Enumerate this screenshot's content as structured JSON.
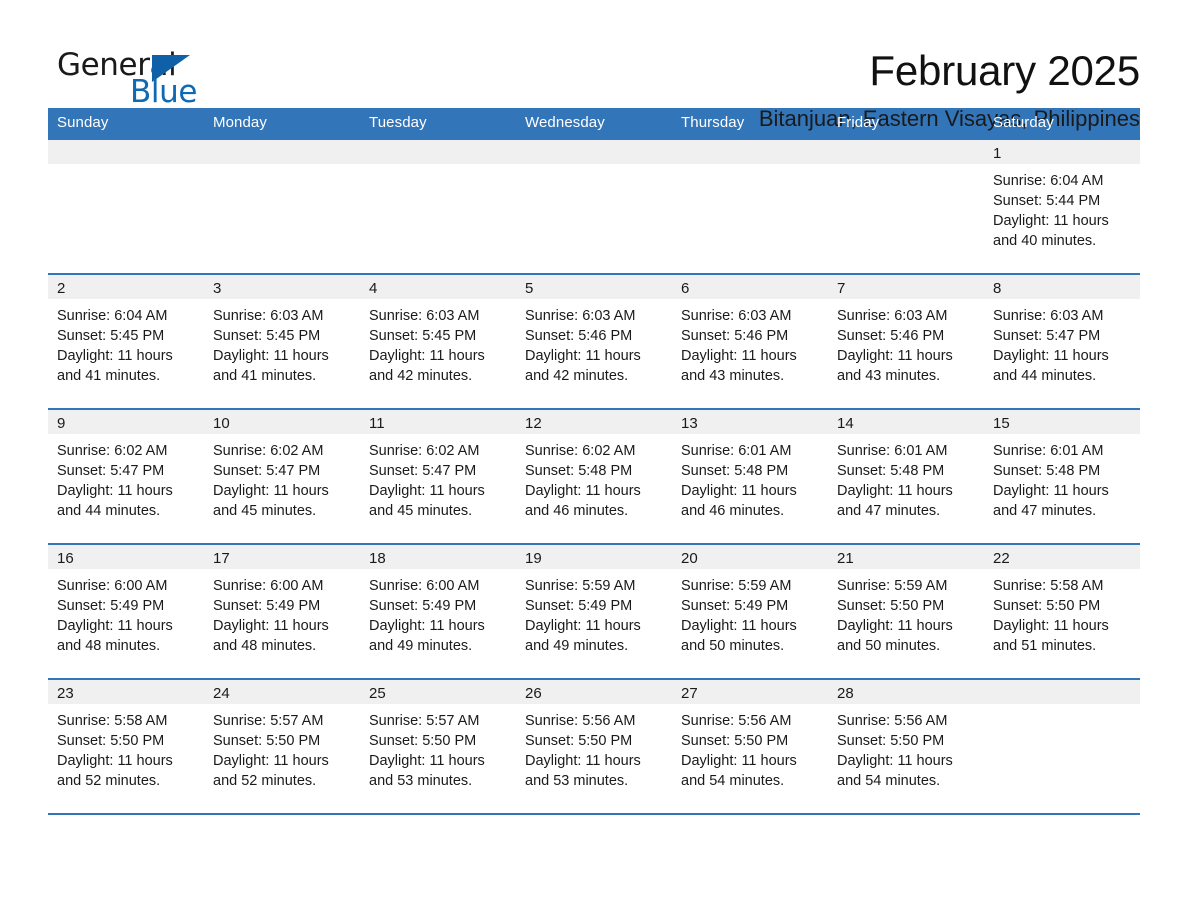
{
  "brand": {
    "name_part1": "General",
    "name_part2": "Blue",
    "triangle_icon": "triangle-icon",
    "accent_color": "#0f6ab4"
  },
  "header": {
    "title": "February 2025",
    "location": "Bitanjuan, Eastern Visayas, Philippines"
  },
  "calendar": {
    "header_bg": "#3275b8",
    "daynum_bg": "#f0f0f0",
    "weekdays": [
      "Sunday",
      "Monday",
      "Tuesday",
      "Wednesday",
      "Thursday",
      "Friday",
      "Saturday"
    ],
    "labels": {
      "sunrise": "Sunrise:",
      "sunset": "Sunset:",
      "daylight": "Daylight:"
    },
    "weeks": [
      [
        {
          "day": ""
        },
        {
          "day": ""
        },
        {
          "day": ""
        },
        {
          "day": ""
        },
        {
          "day": ""
        },
        {
          "day": ""
        },
        {
          "day": "1",
          "sunrise": "Sunrise: 6:04 AM",
          "sunset": "Sunset: 5:44 PM",
          "daylight_line1": "Daylight: 11 hours",
          "daylight_line2": "and 40 minutes."
        }
      ],
      [
        {
          "day": "2",
          "sunrise": "Sunrise: 6:04 AM",
          "sunset": "Sunset: 5:45 PM",
          "daylight_line1": "Daylight: 11 hours",
          "daylight_line2": "and 41 minutes."
        },
        {
          "day": "3",
          "sunrise": "Sunrise: 6:03 AM",
          "sunset": "Sunset: 5:45 PM",
          "daylight_line1": "Daylight: 11 hours",
          "daylight_line2": "and 41 minutes."
        },
        {
          "day": "4",
          "sunrise": "Sunrise: 6:03 AM",
          "sunset": "Sunset: 5:45 PM",
          "daylight_line1": "Daylight: 11 hours",
          "daylight_line2": "and 42 minutes."
        },
        {
          "day": "5",
          "sunrise": "Sunrise: 6:03 AM",
          "sunset": "Sunset: 5:46 PM",
          "daylight_line1": "Daylight: 11 hours",
          "daylight_line2": "and 42 minutes."
        },
        {
          "day": "6",
          "sunrise": "Sunrise: 6:03 AM",
          "sunset": "Sunset: 5:46 PM",
          "daylight_line1": "Daylight: 11 hours",
          "daylight_line2": "and 43 minutes."
        },
        {
          "day": "7",
          "sunrise": "Sunrise: 6:03 AM",
          "sunset": "Sunset: 5:46 PM",
          "daylight_line1": "Daylight: 11 hours",
          "daylight_line2": "and 43 minutes."
        },
        {
          "day": "8",
          "sunrise": "Sunrise: 6:03 AM",
          "sunset": "Sunset: 5:47 PM",
          "daylight_line1": "Daylight: 11 hours",
          "daylight_line2": "and 44 minutes."
        }
      ],
      [
        {
          "day": "9",
          "sunrise": "Sunrise: 6:02 AM",
          "sunset": "Sunset: 5:47 PM",
          "daylight_line1": "Daylight: 11 hours",
          "daylight_line2": "and 44 minutes."
        },
        {
          "day": "10",
          "sunrise": "Sunrise: 6:02 AM",
          "sunset": "Sunset: 5:47 PM",
          "daylight_line1": "Daylight: 11 hours",
          "daylight_line2": "and 45 minutes."
        },
        {
          "day": "11",
          "sunrise": "Sunrise: 6:02 AM",
          "sunset": "Sunset: 5:47 PM",
          "daylight_line1": "Daylight: 11 hours",
          "daylight_line2": "and 45 minutes."
        },
        {
          "day": "12",
          "sunrise": "Sunrise: 6:02 AM",
          "sunset": "Sunset: 5:48 PM",
          "daylight_line1": "Daylight: 11 hours",
          "daylight_line2": "and 46 minutes."
        },
        {
          "day": "13",
          "sunrise": "Sunrise: 6:01 AM",
          "sunset": "Sunset: 5:48 PM",
          "daylight_line1": "Daylight: 11 hours",
          "daylight_line2": "and 46 minutes."
        },
        {
          "day": "14",
          "sunrise": "Sunrise: 6:01 AM",
          "sunset": "Sunset: 5:48 PM",
          "daylight_line1": "Daylight: 11 hours",
          "daylight_line2": "and 47 minutes."
        },
        {
          "day": "15",
          "sunrise": "Sunrise: 6:01 AM",
          "sunset": "Sunset: 5:48 PM",
          "daylight_line1": "Daylight: 11 hours",
          "daylight_line2": "and 47 minutes."
        }
      ],
      [
        {
          "day": "16",
          "sunrise": "Sunrise: 6:00 AM",
          "sunset": "Sunset: 5:49 PM",
          "daylight_line1": "Daylight: 11 hours",
          "daylight_line2": "and 48 minutes."
        },
        {
          "day": "17",
          "sunrise": "Sunrise: 6:00 AM",
          "sunset": "Sunset: 5:49 PM",
          "daylight_line1": "Daylight: 11 hours",
          "daylight_line2": "and 48 minutes."
        },
        {
          "day": "18",
          "sunrise": "Sunrise: 6:00 AM",
          "sunset": "Sunset: 5:49 PM",
          "daylight_line1": "Daylight: 11 hours",
          "daylight_line2": "and 49 minutes."
        },
        {
          "day": "19",
          "sunrise": "Sunrise: 5:59 AM",
          "sunset": "Sunset: 5:49 PM",
          "daylight_line1": "Daylight: 11 hours",
          "daylight_line2": "and 49 minutes."
        },
        {
          "day": "20",
          "sunrise": "Sunrise: 5:59 AM",
          "sunset": "Sunset: 5:49 PM",
          "daylight_line1": "Daylight: 11 hours",
          "daylight_line2": "and 50 minutes."
        },
        {
          "day": "21",
          "sunrise": "Sunrise: 5:59 AM",
          "sunset": "Sunset: 5:50 PM",
          "daylight_line1": "Daylight: 11 hours",
          "daylight_line2": "and 50 minutes."
        },
        {
          "day": "22",
          "sunrise": "Sunrise: 5:58 AM",
          "sunset": "Sunset: 5:50 PM",
          "daylight_line1": "Daylight: 11 hours",
          "daylight_line2": "and 51 minutes."
        }
      ],
      [
        {
          "day": "23",
          "sunrise": "Sunrise: 5:58 AM",
          "sunset": "Sunset: 5:50 PM",
          "daylight_line1": "Daylight: 11 hours",
          "daylight_line2": "and 52 minutes."
        },
        {
          "day": "24",
          "sunrise": "Sunrise: 5:57 AM",
          "sunset": "Sunset: 5:50 PM",
          "daylight_line1": "Daylight: 11 hours",
          "daylight_line2": "and 52 minutes."
        },
        {
          "day": "25",
          "sunrise": "Sunrise: 5:57 AM",
          "sunset": "Sunset: 5:50 PM",
          "daylight_line1": "Daylight: 11 hours",
          "daylight_line2": "and 53 minutes."
        },
        {
          "day": "26",
          "sunrise": "Sunrise: 5:56 AM",
          "sunset": "Sunset: 5:50 PM",
          "daylight_line1": "Daylight: 11 hours",
          "daylight_line2": "and 53 minutes."
        },
        {
          "day": "27",
          "sunrise": "Sunrise: 5:56 AM",
          "sunset": "Sunset: 5:50 PM",
          "daylight_line1": "Daylight: 11 hours",
          "daylight_line2": "and 54 minutes."
        },
        {
          "day": "28",
          "sunrise": "Sunrise: 5:56 AM",
          "sunset": "Sunset: 5:50 PM",
          "daylight_line1": "Daylight: 11 hours",
          "daylight_line2": "and 54 minutes."
        },
        {
          "day": ""
        }
      ]
    ]
  }
}
